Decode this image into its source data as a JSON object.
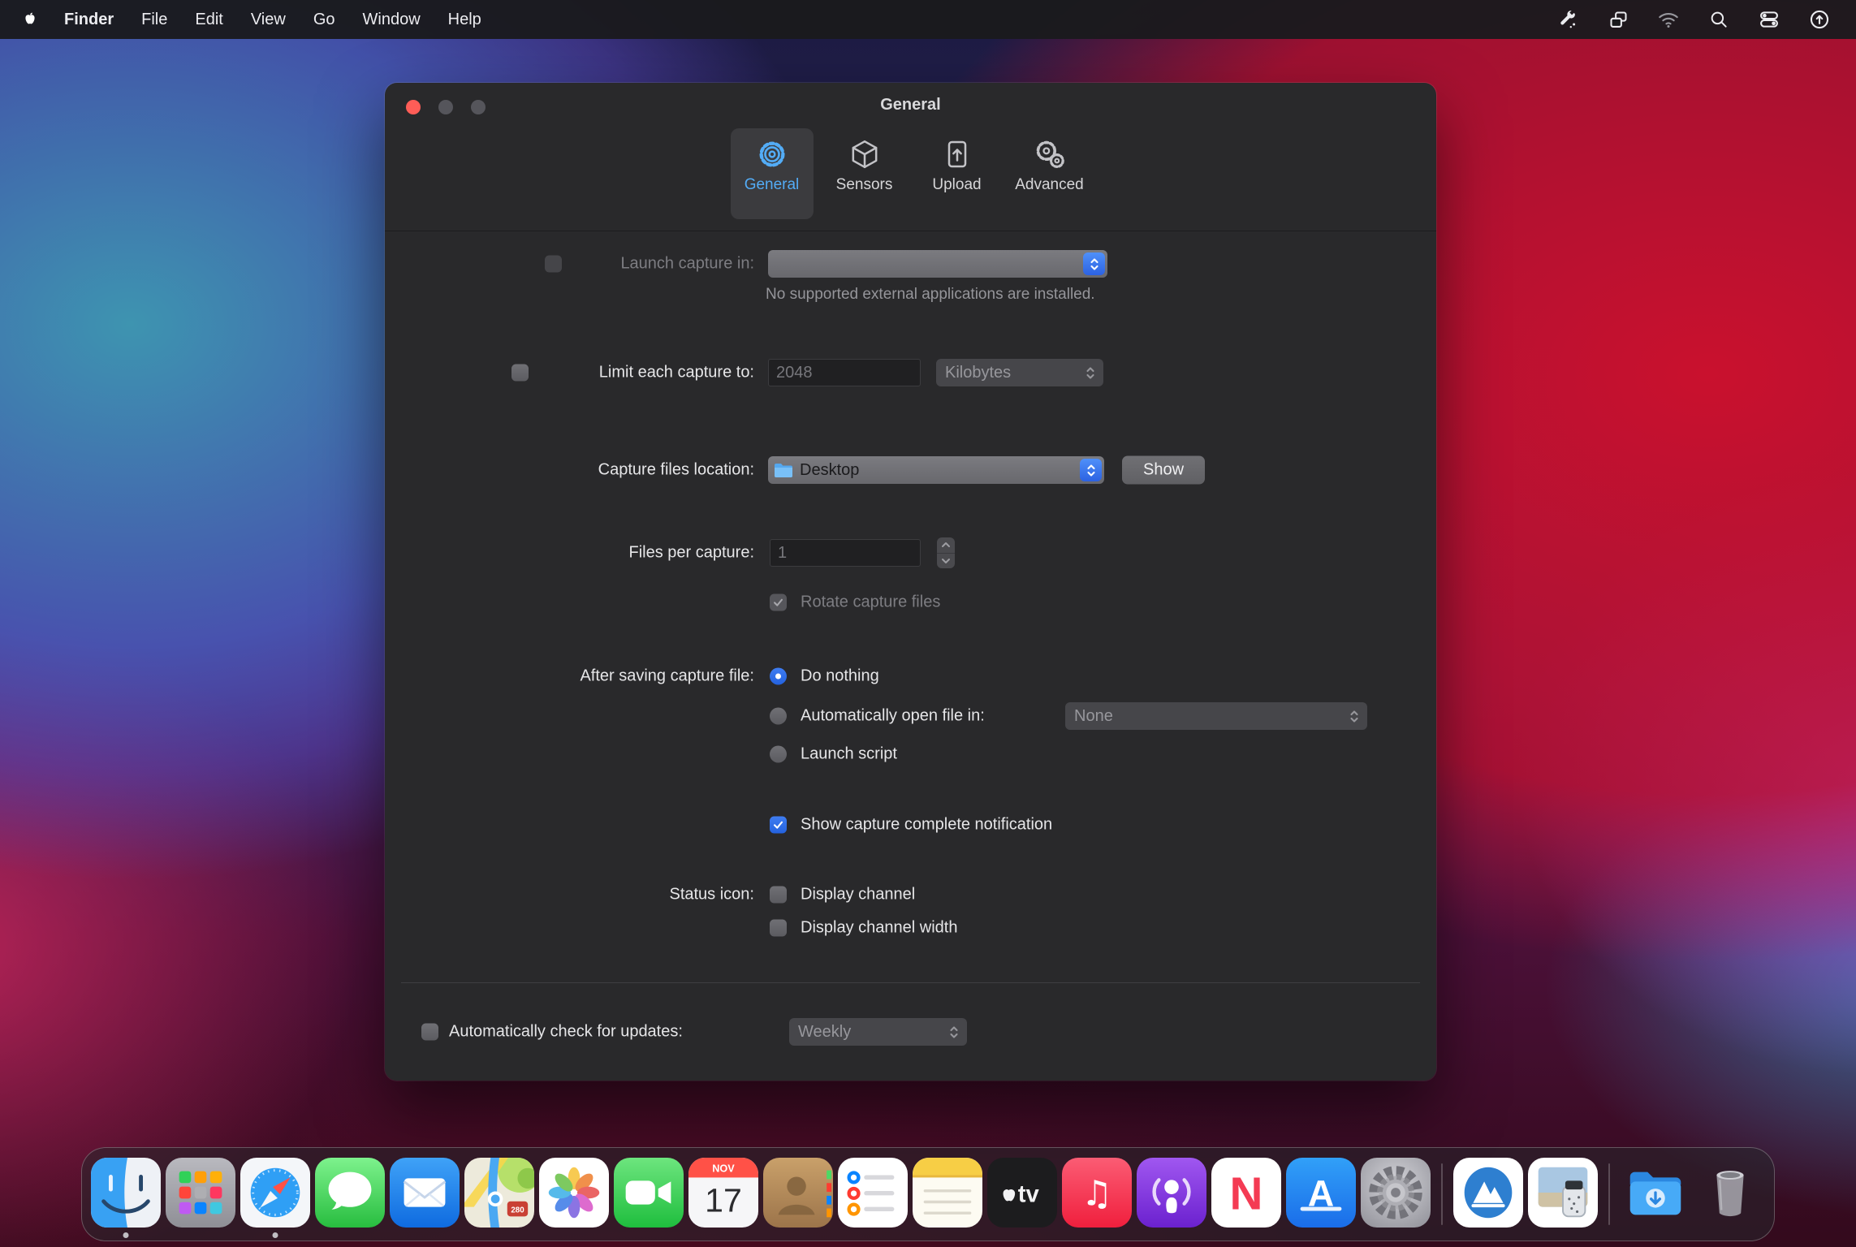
{
  "menu_bar": {
    "app_name": "Finder",
    "items": [
      "File",
      "Edit",
      "View",
      "Go",
      "Window",
      "Help"
    ],
    "status_icons": [
      "tools-icon",
      "windows-stack-icon",
      "wifi-icon",
      "search-icon",
      "control-center-icon",
      "circle-arrow-icon"
    ]
  },
  "window": {
    "title": "General",
    "accent_color": "#53acf6",
    "tabs": [
      {
        "label": "General",
        "selected": true
      },
      {
        "label": "Sensors",
        "selected": false
      },
      {
        "label": "Upload",
        "selected": false
      },
      {
        "label": "Advanced",
        "selected": false
      }
    ],
    "rows": {
      "launch_capture": {
        "label": "Launch capture in:",
        "checked": false,
        "enabled": false,
        "popup_value": "",
        "help": "No supported external applications are installed."
      },
      "limit_capture": {
        "label": "Limit each capture to:",
        "checked": false,
        "field_value": "2048",
        "unit": "Kilobytes"
      },
      "capture_location": {
        "label": "Capture files location:",
        "popup_value": "Desktop",
        "button_label": "Show"
      },
      "files_per_capture": {
        "label": "Files per capture:",
        "field_value": "1"
      },
      "rotate": {
        "label": "Rotate capture files",
        "checked": true,
        "enabled": false
      },
      "after_saving": {
        "label": "After saving capture file:",
        "options": [
          {
            "label": "Do nothing",
            "selected": true
          },
          {
            "label": "Automatically open file in:",
            "selected": false,
            "popup_value": "None"
          },
          {
            "label": "Launch script",
            "selected": false
          }
        ]
      },
      "notification": {
        "label": "Show capture complete notification",
        "checked": true
      },
      "status_icon": {
        "label": "Status icon:",
        "options": [
          {
            "label": "Display channel",
            "checked": false
          },
          {
            "label": "Display channel width",
            "checked": false
          }
        ]
      },
      "updates": {
        "label": "Automatically check for updates:",
        "checked": false,
        "popup_value": "Weekly"
      }
    }
  },
  "dock": {
    "calendar": {
      "month": "NOV",
      "day": "17"
    },
    "tv_label": "tv",
    "music_glyph": "♫",
    "maps_shield": "280",
    "news_letter": "N",
    "appstore_letter": "A",
    "icons": [
      "finder",
      "launchpad",
      "safari",
      "messages",
      "mail",
      "maps",
      "photos",
      "facetime",
      "calendar",
      "contacts",
      "reminders",
      "notes",
      "apple-tv",
      "music",
      "podcasts",
      "news",
      "app-store",
      "system-preferences",
      "mountain-app",
      "photo-utility-app",
      "downloads-folder",
      "trash"
    ]
  }
}
